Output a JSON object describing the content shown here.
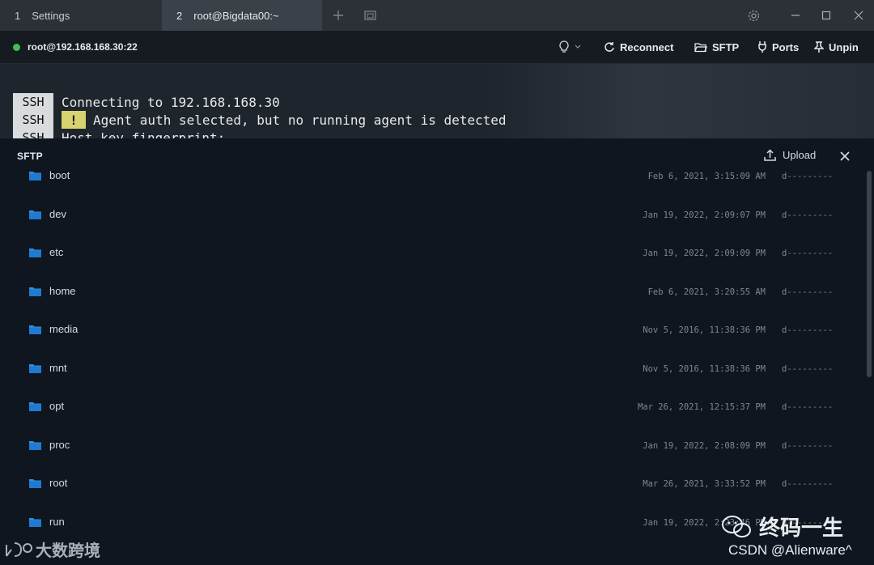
{
  "tabs": [
    {
      "num": "1",
      "label": "Settings"
    },
    {
      "num": "2",
      "label": "root@Bigdata00:~"
    }
  ],
  "toolbar": {
    "host": "root@192.168.168.30:22",
    "reconnect": "Reconnect",
    "sftp": "SFTP",
    "ports": "Ports",
    "unpin": "Unpin"
  },
  "terminal": {
    "tag": "SSH",
    "warn_mark": "!",
    "line1": "Connecting to 192.168.168.30",
    "line2": "Agent auth selected, but no running agent is detected",
    "line3": "Host key fingerprint:"
  },
  "sftp": {
    "title": "SFTP",
    "upload": "Upload",
    "files": [
      {
        "name": "boot",
        "date": "Feb 6, 2021, 3:15:09 AM",
        "perm": "d---------"
      },
      {
        "name": "dev",
        "date": "Jan 19, 2022, 2:09:07 PM",
        "perm": "d---------"
      },
      {
        "name": "etc",
        "date": "Jan 19, 2022, 2:09:09 PM",
        "perm": "d---------"
      },
      {
        "name": "home",
        "date": "Feb 6, 2021, 3:20:55 AM",
        "perm": "d---------"
      },
      {
        "name": "media",
        "date": "Nov 5, 2016, 11:38:36 PM",
        "perm": "d---------"
      },
      {
        "name": "mnt",
        "date": "Nov 5, 2016, 11:38:36 PM",
        "perm": "d---------"
      },
      {
        "name": "opt",
        "date": "Mar 26, 2021, 12:15:37 PM",
        "perm": "d---------"
      },
      {
        "name": "proc",
        "date": "Jan 19, 2022, 2:08:09 PM",
        "perm": "d---------"
      },
      {
        "name": "root",
        "date": "Mar 26, 2021, 3:33:52 PM",
        "perm": "d---------"
      },
      {
        "name": "run",
        "date": "Jan 19, 2022, 2:23:46 PM",
        "perm": "d---------"
      }
    ]
  },
  "watermarks": {
    "left": "大数跨境",
    "right": "终码一生",
    "csdn": "CSDN @Alienware^"
  },
  "colors": {
    "status_online": "#3fbf52",
    "folder": "#2f8fe0",
    "warn_bg": "#d7d36e"
  }
}
